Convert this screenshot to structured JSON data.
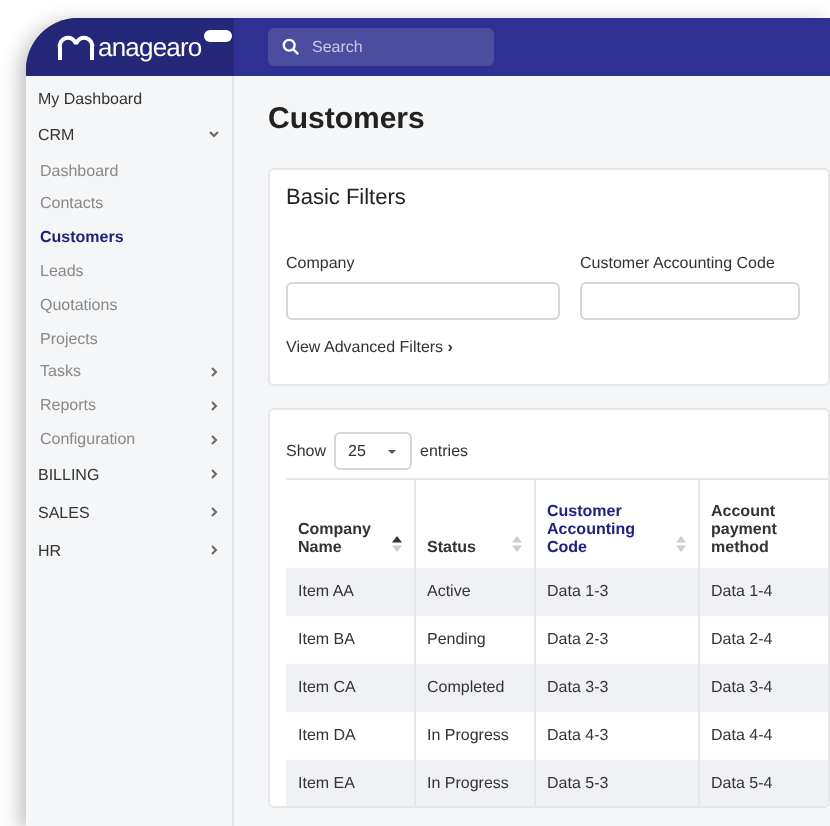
{
  "header": {
    "logo": "anagearo",
    "search": {
      "placeholder": "Search"
    }
  },
  "sidebar": {
    "items": [
      {
        "label": "My Dashboard",
        "kind": "link",
        "selected": false
      },
      {
        "label": "CRM",
        "kind": "group",
        "expanded": true,
        "children": [
          {
            "label": "Dashboard",
            "selected": false
          },
          {
            "label": "Contacts",
            "selected": false
          },
          {
            "label": "Customers",
            "selected": true
          },
          {
            "label": "Leads",
            "selected": false
          },
          {
            "label": "Quotations",
            "selected": false
          },
          {
            "label": "Projects",
            "selected": false
          },
          {
            "label": "Tasks",
            "expanded": false,
            "selected": false
          },
          {
            "label": "Reports",
            "expanded": false,
            "selected": false
          },
          {
            "label": "Configuration",
            "expanded": false,
            "selected": false
          }
        ]
      },
      {
        "label": "BILLING",
        "kind": "group",
        "expanded": false
      },
      {
        "label": "SALES",
        "kind": "group",
        "expanded": false
      },
      {
        "label": "HR",
        "kind": "group",
        "expanded": false
      }
    ]
  },
  "page_title": "Customers",
  "filters": {
    "title": "Basic Filters",
    "fields": [
      {
        "label": "Company"
      },
      {
        "label": "Customer Accounting Code"
      }
    ],
    "advanced_link": "View Advanced Filters",
    "advanced_icon": "›"
  },
  "table": {
    "show_label": "Show",
    "page_size": "25",
    "entries_label": "entries",
    "columns": [
      {
        "label": "Company Name",
        "sortable": true,
        "sorted": true,
        "highlighted": false
      },
      {
        "label": "Status",
        "sortable": true,
        "sorted": false,
        "highlighted": false
      },
      {
        "label": "Customer Accounting Code",
        "sortable": true,
        "sorted": false,
        "highlighted": true
      },
      {
        "label": "Account payment method",
        "sortable": false,
        "highlighted": false
      }
    ],
    "rows": [
      [
        "Item AA",
        "Active",
        "Data 1-3",
        "Data 1-4"
      ],
      [
        "Item BA",
        "Pending",
        "Data 2-3",
        "Data 2-4"
      ],
      [
        "Item CA",
        "Completed",
        "Data 3-3",
        "Data 3-4"
      ],
      [
        "Item DA",
        "In Progress",
        "Data 4-3",
        "Data 4-4"
      ],
      [
        "Item EA",
        "In Progress",
        "Data 5-3",
        "Data 5-4"
      ]
    ]
  }
}
